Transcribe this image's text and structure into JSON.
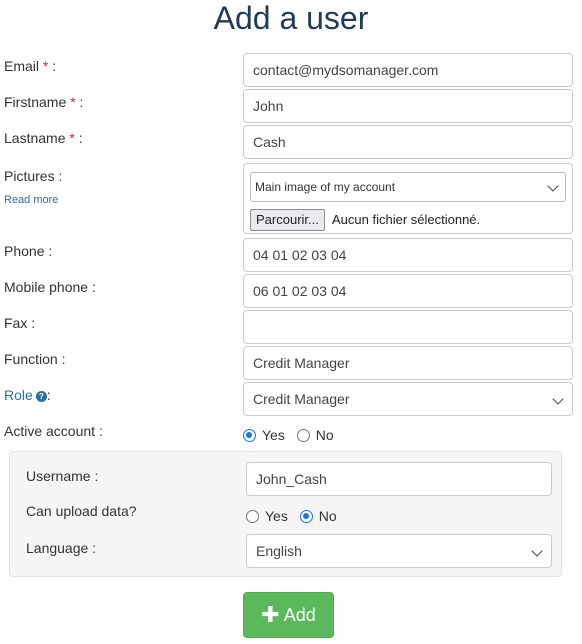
{
  "page": {
    "title": "Add a user"
  },
  "form": {
    "email": {
      "label": "Email",
      "required_mark": "*",
      "suffix": " :",
      "value": "contact@mydsomanager.com"
    },
    "firstname": {
      "label": "Firstname",
      "required_mark": "*",
      "suffix": " :",
      "value": "John"
    },
    "lastname": {
      "label": "Lastname",
      "required_mark": "*",
      "suffix": " :",
      "value": "Cash"
    },
    "pictures": {
      "label": "Pictures :",
      "read_more": "Read more",
      "select_value": "Main image of my account",
      "browse_label": "Parcourir...",
      "no_file_text": "Aucun fichier sélectionné."
    },
    "phone": {
      "label": "Phone :",
      "value": "04 01 02 03 04"
    },
    "mobile": {
      "label": "Mobile phone :",
      "value": "06 01 02 03 04"
    },
    "fax": {
      "label": "Fax :",
      "value": ""
    },
    "function": {
      "label": "Function :",
      "value": "Credit Manager"
    },
    "role": {
      "label": "Role",
      "help_icon": "help-icon",
      "suffix": ":",
      "value": "Credit Manager"
    },
    "active_account": {
      "label": "Active account :",
      "options": [
        {
          "label": "Yes",
          "checked": true
        },
        {
          "label": "No",
          "checked": false
        }
      ]
    }
  },
  "account_panel": {
    "username": {
      "label": "Username :",
      "value": "John_Cash"
    },
    "can_upload": {
      "label": "Can upload data?",
      "options": [
        {
          "label": "Yes",
          "checked": false
        },
        {
          "label": "No",
          "checked": true
        }
      ]
    },
    "language": {
      "label": "Language :",
      "value": "English"
    }
  },
  "actions": {
    "add_label": "Add",
    "add_icon": "plus-icon"
  },
  "colors": {
    "title": "#1f3b57",
    "required": "#c9302c",
    "link": "#2a6ea6",
    "add_button": "#5cb85c",
    "radio_checked": "#1a73e8"
  }
}
